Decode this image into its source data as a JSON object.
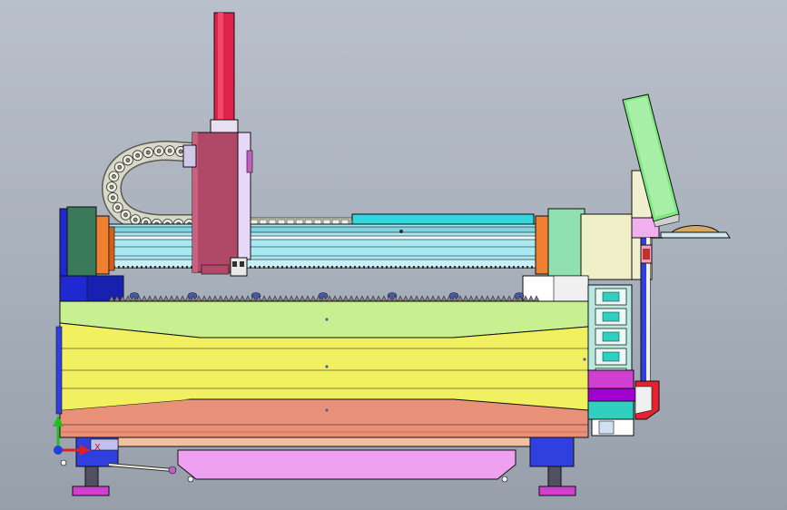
{
  "viewport": {
    "background": "#a9b1bd"
  },
  "triad": {
    "x_label": "X",
    "x_color": "#e02020",
    "y_color": "#20c020",
    "z_color": "#2040e0"
  },
  "colors": {
    "z_axis_column": "#e0224a",
    "carriage_plate": "#b04868",
    "gantry_tube": "#a8e8f0",
    "cable_chain": "#d8d8c8",
    "end_block_blue": "#2028d0",
    "end_block_green": "#3a7a5a",
    "orange_bracket": "#f08030",
    "table_top": "#c8f090",
    "table_body": "#f0f060",
    "table_bottom": "#e89078",
    "base_drawer": "#f0a0f0",
    "control_panel": "#80e880",
    "cable_chain_side": "#30d0c0"
  }
}
